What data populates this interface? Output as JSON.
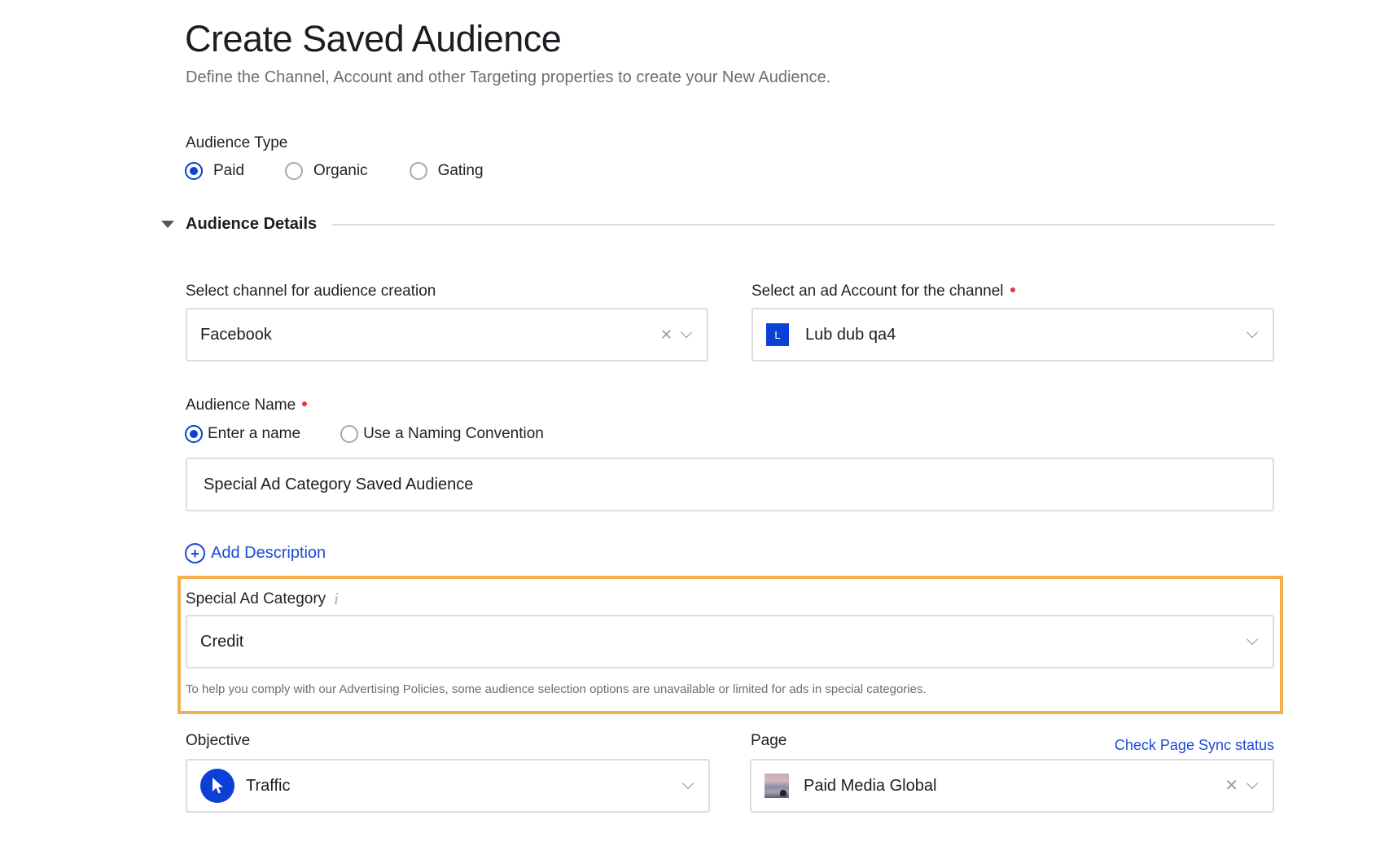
{
  "header": {
    "title": "Create Saved Audience",
    "subtitle": "Define the Channel, Account and other Targeting properties to create your New Audience."
  },
  "audience_type": {
    "label": "Audience Type",
    "options": [
      {
        "label": "Paid",
        "checked": true
      },
      {
        "label": "Organic",
        "checked": false
      },
      {
        "label": "Gating",
        "checked": false
      }
    ]
  },
  "section": {
    "title": "Audience Details",
    "icon": "caret-down-icon"
  },
  "channel": {
    "label": "Select channel for audience creation",
    "value": "Facebook"
  },
  "ad_account": {
    "label": "Select an ad Account for the channel",
    "required": true,
    "badge": "L",
    "value": "Lub dub qa4"
  },
  "audience_name": {
    "label": "Audience Name",
    "required": true,
    "options": [
      {
        "label": "Enter a name",
        "checked": true
      },
      {
        "label": "Use a Naming Convention",
        "checked": false
      }
    ],
    "value": "Special Ad Category Saved Audience"
  },
  "add_description": {
    "icon": "+",
    "label": "Add Description"
  },
  "special_ad_category": {
    "label": "Special Ad Category",
    "info_icon": "i",
    "value": "Credit",
    "helper": "To help you comply with our Advertising Policies, some audience selection options are unavailable or limited for ads in special categories.",
    "highlight_color": "#f1b14e"
  },
  "objective": {
    "label": "Objective",
    "value": "Traffic"
  },
  "page": {
    "label": "Page",
    "link": "Check Page Sync status",
    "value": "Paid Media Global"
  },
  "colors": {
    "accent": "#0b3fd6",
    "link": "#1a4bd4",
    "required": "#e0393e"
  }
}
